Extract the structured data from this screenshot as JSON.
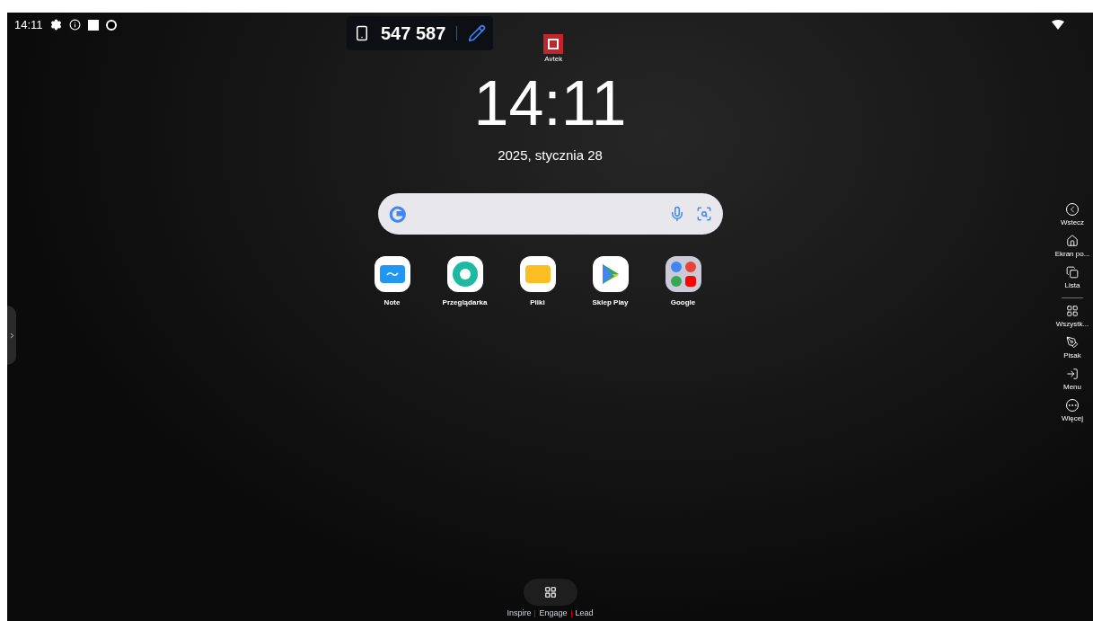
{
  "status_bar": {
    "time": "14:11"
  },
  "cast": {
    "code": "547 587"
  },
  "logo": {
    "label": "Avtek"
  },
  "clock": {
    "time": "14:11",
    "date": "2025, stycznia 28"
  },
  "apps": [
    {
      "label": "Note",
      "kind": "note"
    },
    {
      "label": "Przeglądarka",
      "kind": "browser"
    },
    {
      "label": "Pliki",
      "kind": "files"
    },
    {
      "label": "Sklep Play",
      "kind": "play"
    },
    {
      "label": "Google",
      "kind": "folder"
    }
  ],
  "dock": [
    {
      "label": "Wstecz",
      "kind": "back"
    },
    {
      "label": "Ekran po...",
      "kind": "home"
    },
    {
      "label": "Lista",
      "kind": "list"
    },
    {
      "label": "Wszystk...",
      "kind": "all"
    },
    {
      "label": "Pisak",
      "kind": "pen"
    },
    {
      "label": "Menu",
      "kind": "menu"
    },
    {
      "label": "Więcej",
      "kind": "more"
    }
  ],
  "footer": [
    "Inspire",
    "Engage",
    "Lead"
  ]
}
